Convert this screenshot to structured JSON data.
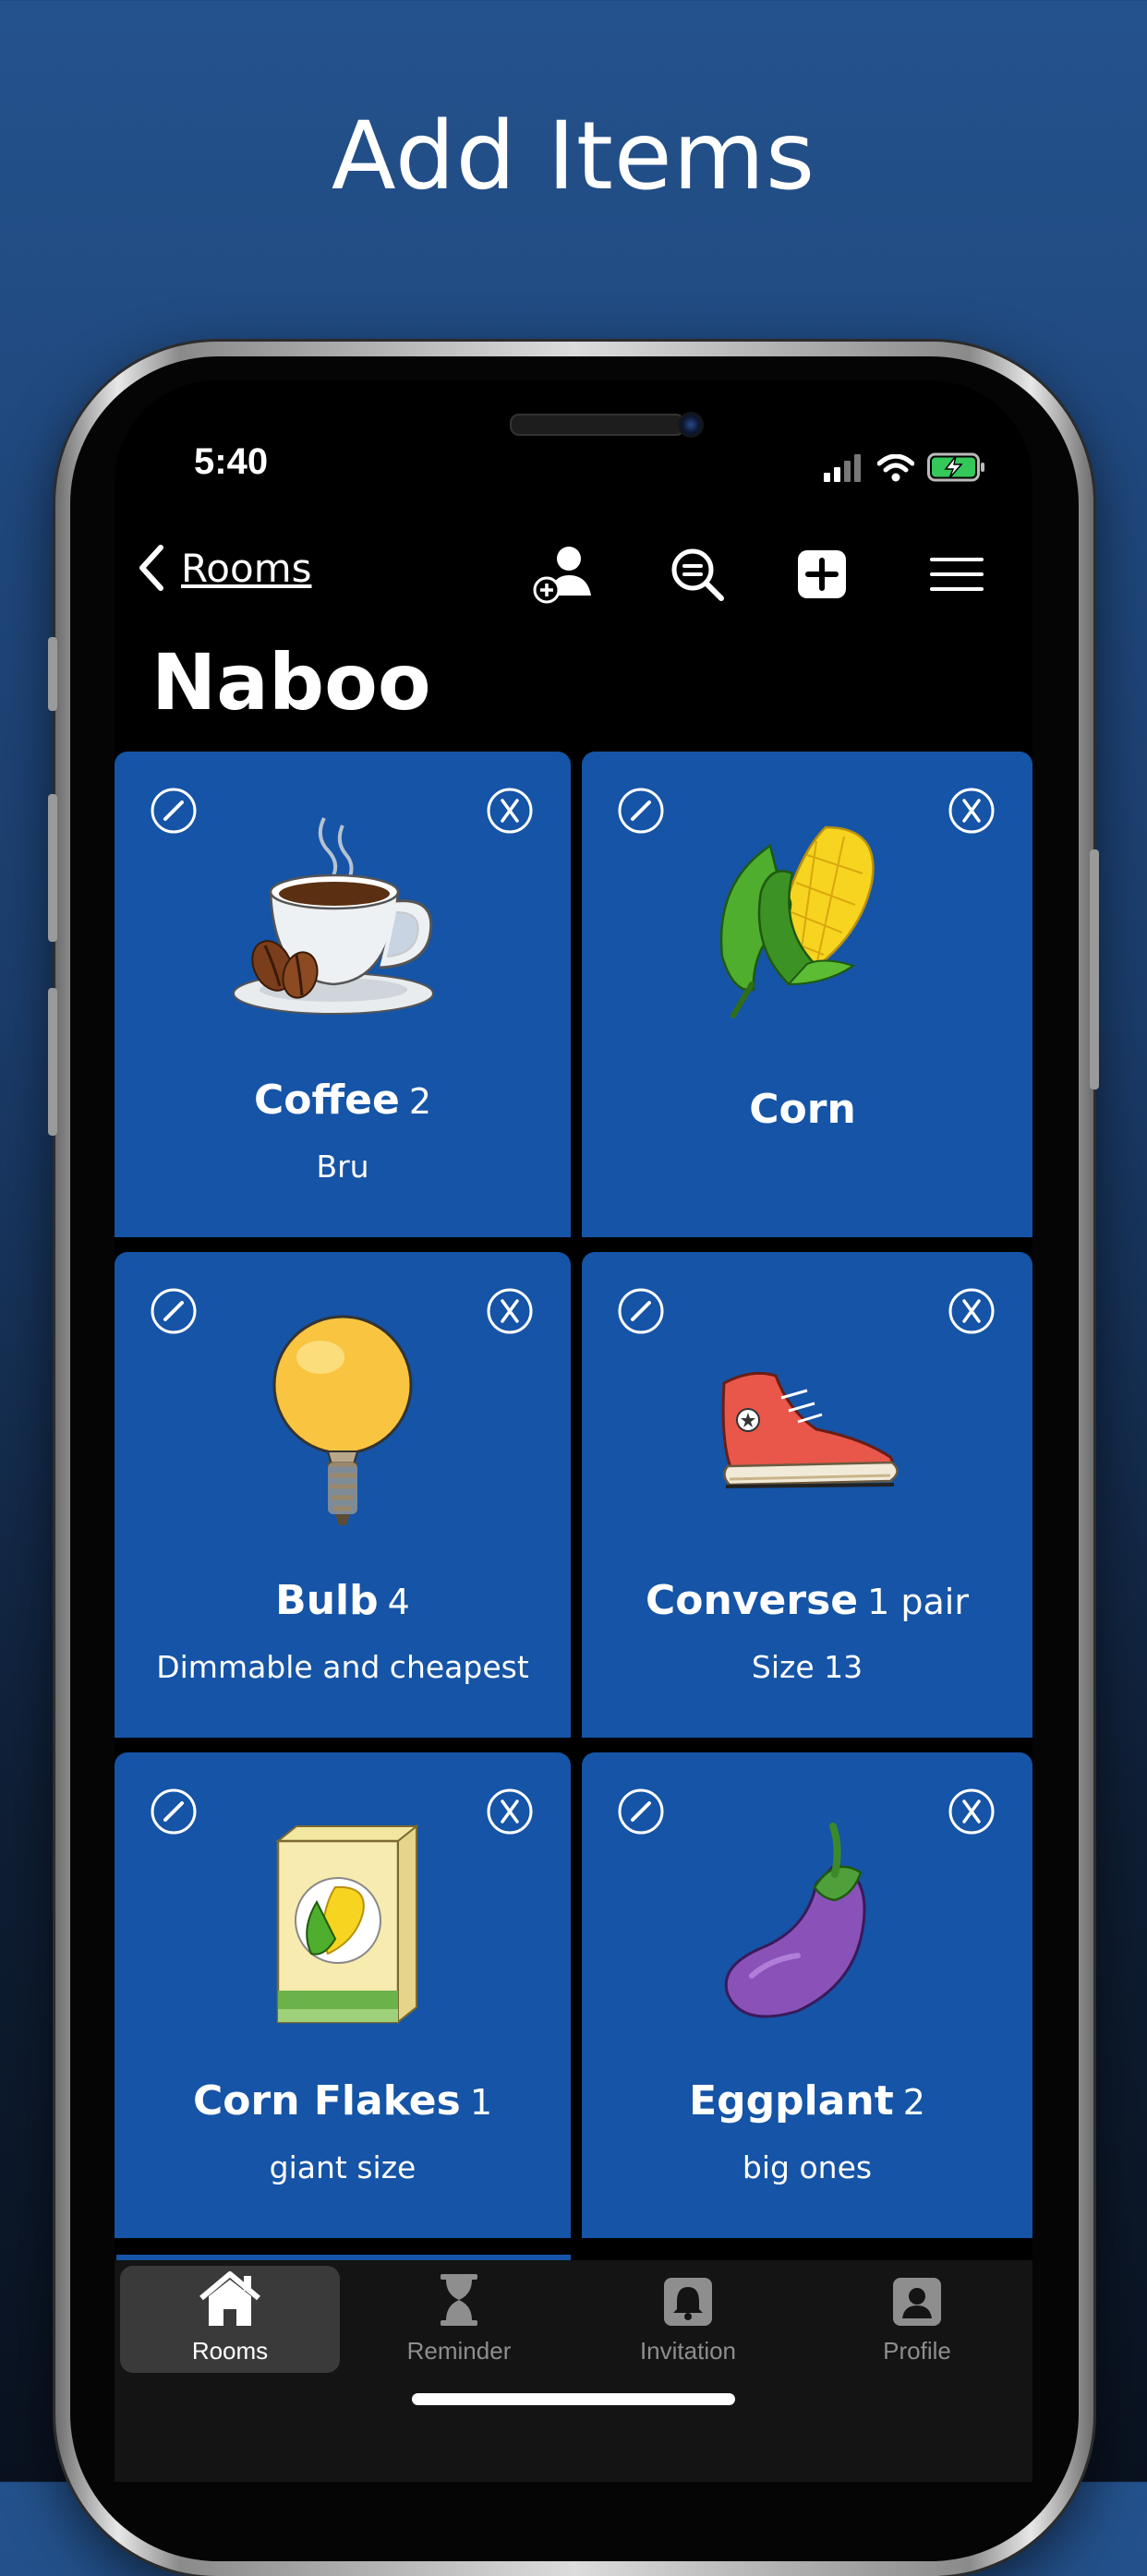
{
  "headline": "Add Items",
  "status_bar": {
    "time": "5:40"
  },
  "nav": {
    "back_label": "Rooms",
    "icons": [
      "add-person-icon",
      "search-icon",
      "add-icon",
      "menu-icon"
    ]
  },
  "room": {
    "title": "Naboo"
  },
  "items": [
    {
      "name": "Coffee",
      "qty": "2",
      "desc": "Bru",
      "icon": "coffee-cup-image"
    },
    {
      "name": "Corn",
      "qty": "",
      "desc": "",
      "icon": "corn-image"
    },
    {
      "name": "Bulb",
      "qty": "4",
      "desc": "Dimmable and cheapest",
      "icon": "bulb-image"
    },
    {
      "name": "Converse",
      "qty": "1 pair",
      "desc": "Size 13",
      "icon": "sneaker-image"
    },
    {
      "name": "Corn Flakes",
      "qty": "1",
      "desc": "giant size",
      "icon": "cereal-box-image"
    },
    {
      "name": "Eggplant",
      "qty": "2",
      "desc": "big ones",
      "icon": "eggplant-image"
    }
  ],
  "tabs": [
    {
      "label": "Rooms",
      "icon": "home-icon",
      "active": true
    },
    {
      "label": "Reminder",
      "icon": "hourglass-icon",
      "active": false
    },
    {
      "label": "Invitation",
      "icon": "bell-icon",
      "active": false
    },
    {
      "label": "Profile",
      "icon": "profile-icon",
      "active": false
    }
  ],
  "colors": {
    "card": "#1554a6",
    "background_top": "#24528d",
    "tabbar": "#141414"
  }
}
